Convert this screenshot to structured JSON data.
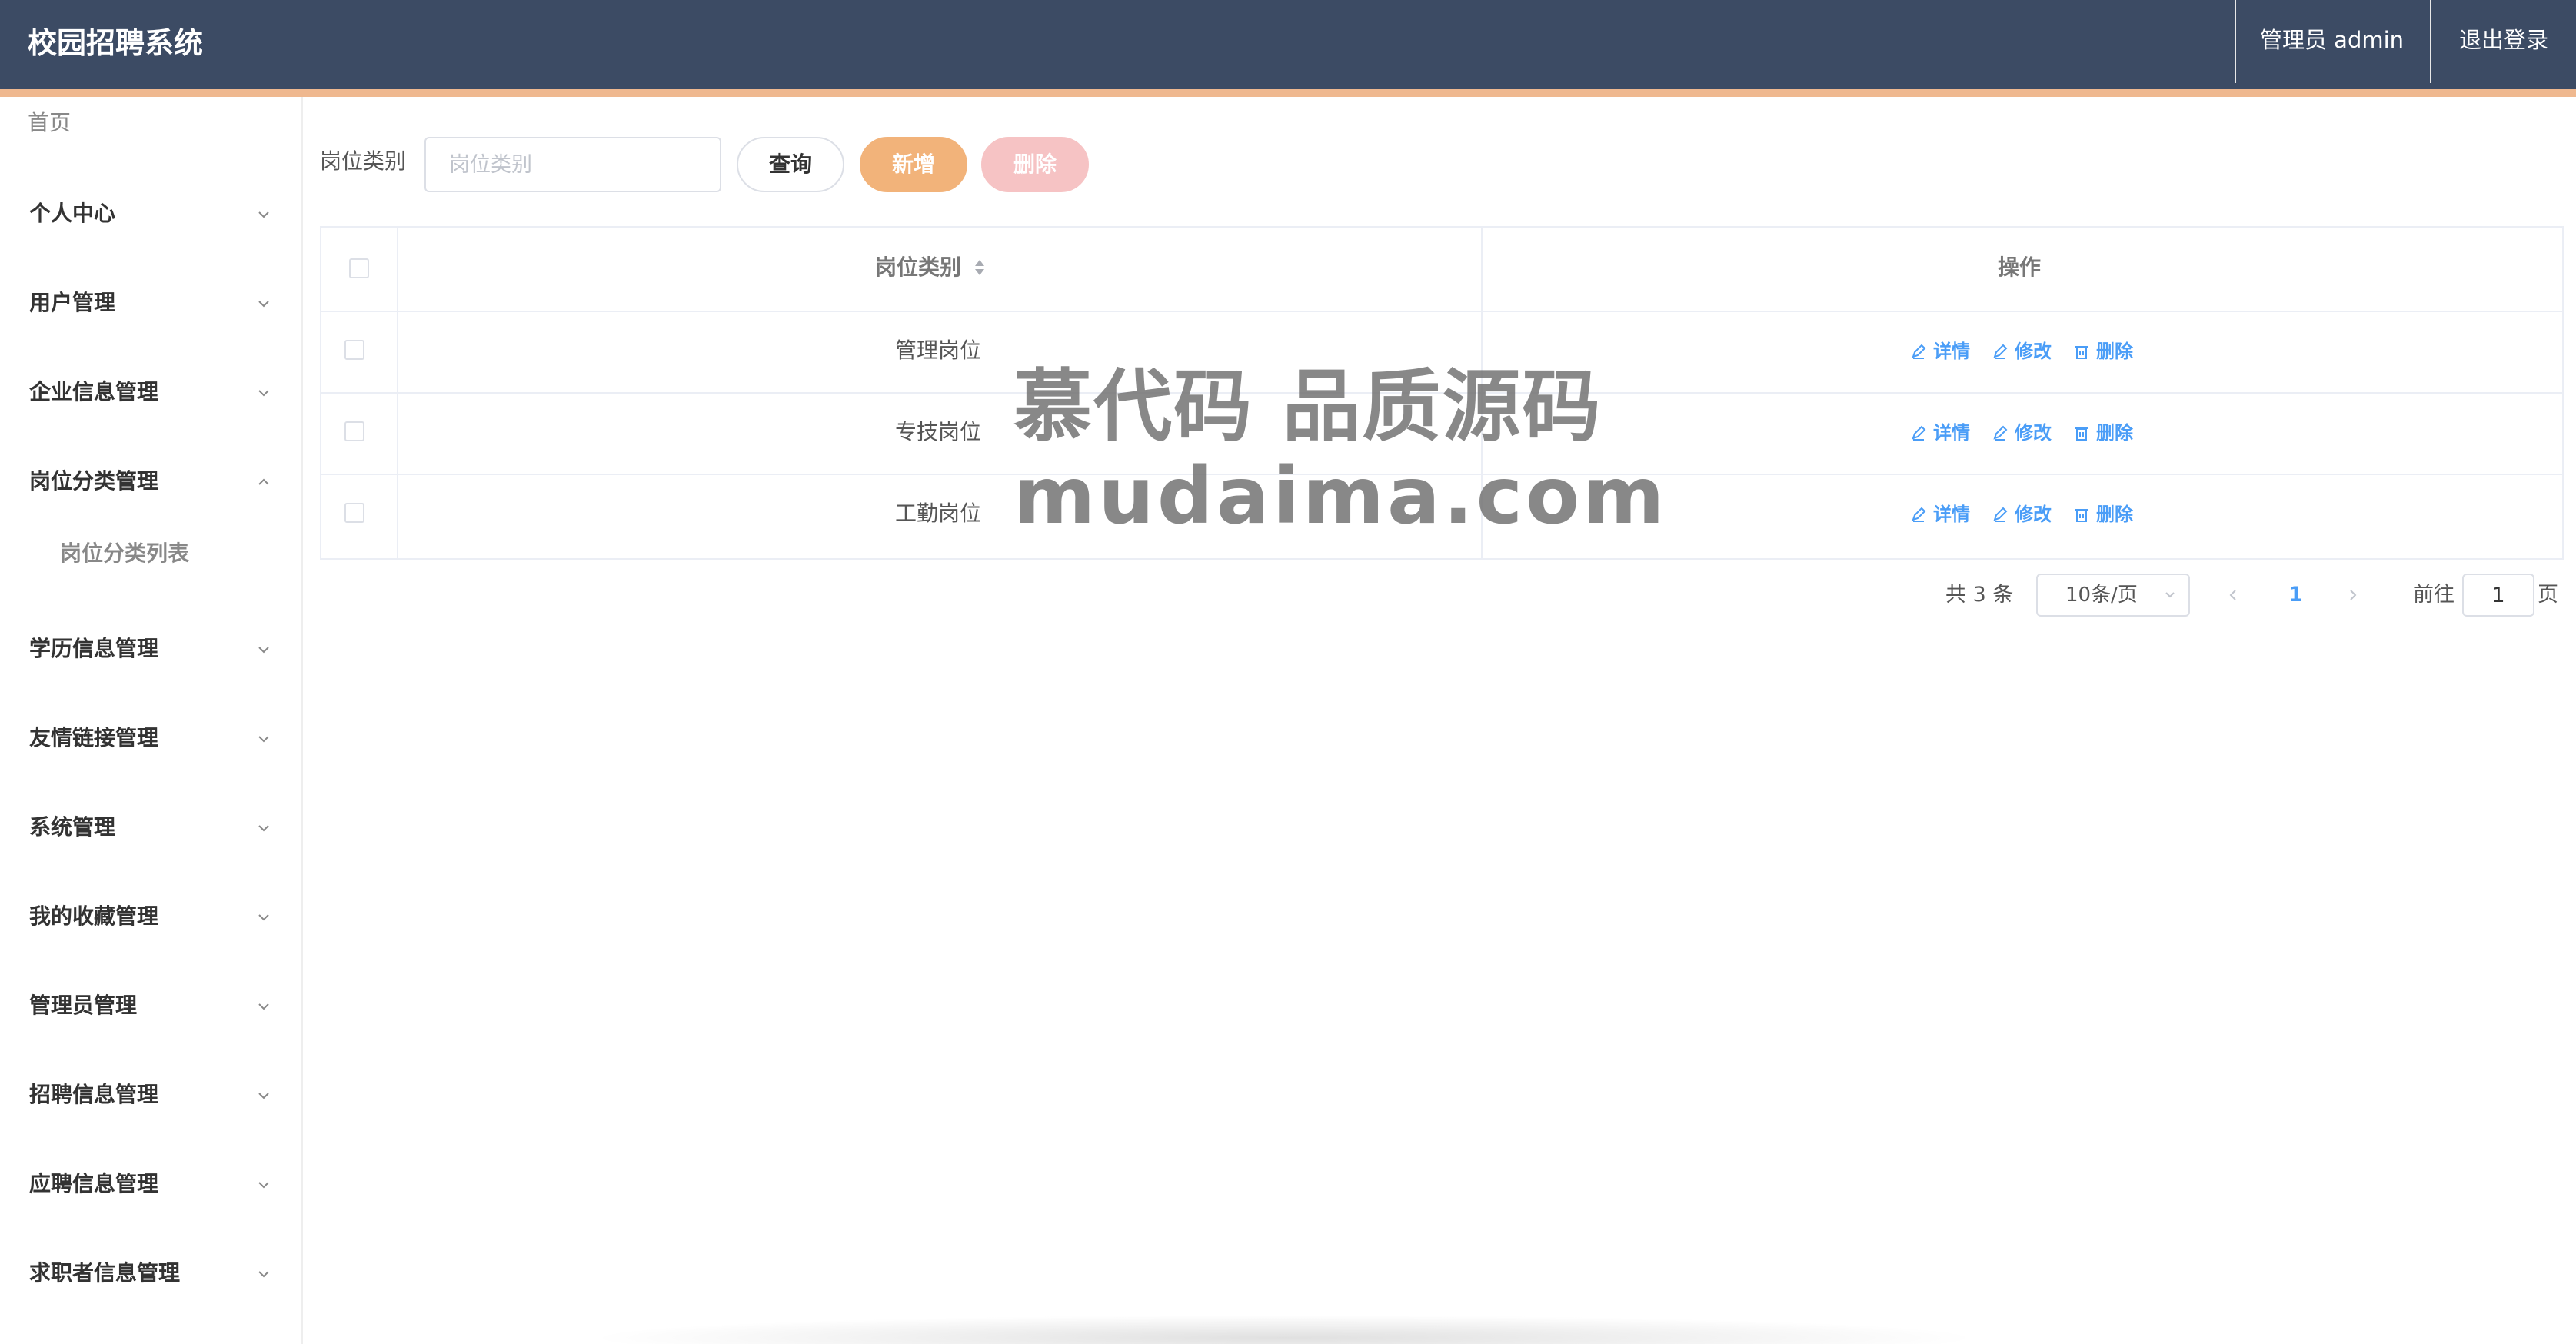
{
  "header": {
    "title": "校园招聘系统",
    "admin_label": "管理员 admin",
    "logout_label": "退出登录",
    "bg_color": "#3c4b64",
    "accent_color": "#efb88f"
  },
  "sidebar": {
    "home": "首页",
    "items": [
      {
        "label": "个人中心",
        "icon": "chevron-down-icon"
      },
      {
        "label": "用户管理",
        "icon": "chevron-down-icon"
      },
      {
        "label": "企业信息管理",
        "icon": "chevron-down-icon"
      },
      {
        "label": "岗位分类管理",
        "icon": "chevron-up-icon",
        "expanded": true,
        "children": [
          {
            "label": "岗位分类列表"
          }
        ]
      },
      {
        "label": "学历信息管理",
        "icon": "chevron-down-icon"
      },
      {
        "label": "友情链接管理",
        "icon": "chevron-down-icon"
      },
      {
        "label": "系统管理",
        "icon": "chevron-down-icon"
      },
      {
        "label": "我的收藏管理",
        "icon": "chevron-down-icon"
      },
      {
        "label": "管理员管理",
        "icon": "chevron-down-icon"
      },
      {
        "label": "招聘信息管理",
        "icon": "chevron-down-icon"
      },
      {
        "label": "应聘信息管理",
        "icon": "chevron-down-icon"
      },
      {
        "label": "求职者信息管理",
        "icon": "chevron-down-icon"
      }
    ]
  },
  "search": {
    "label": "岗位类别",
    "placeholder": "岗位类别",
    "value": "",
    "query_label": "查询",
    "add_label": "新增",
    "delete_label": "删除",
    "add_color": "#f2b37a",
    "delete_color": "#f6c3c4"
  },
  "table": {
    "headers": [
      "岗位类别",
      "操作"
    ],
    "rows": [
      {
        "category": "管理岗位"
      },
      {
        "category": "专技岗位"
      },
      {
        "category": "工勤岗位"
      }
    ],
    "actions": [
      "详情",
      "修改",
      "删除"
    ],
    "action_color": "#4a9df7"
  },
  "pagination": {
    "total": "共 3 条",
    "page_size": "10条/页",
    "current": "1",
    "goto_label": "前往",
    "goto_value": "1",
    "page_label": "页"
  },
  "watermark": {
    "line1": "慕代码 品质源码",
    "line2": "mudaima.com"
  }
}
